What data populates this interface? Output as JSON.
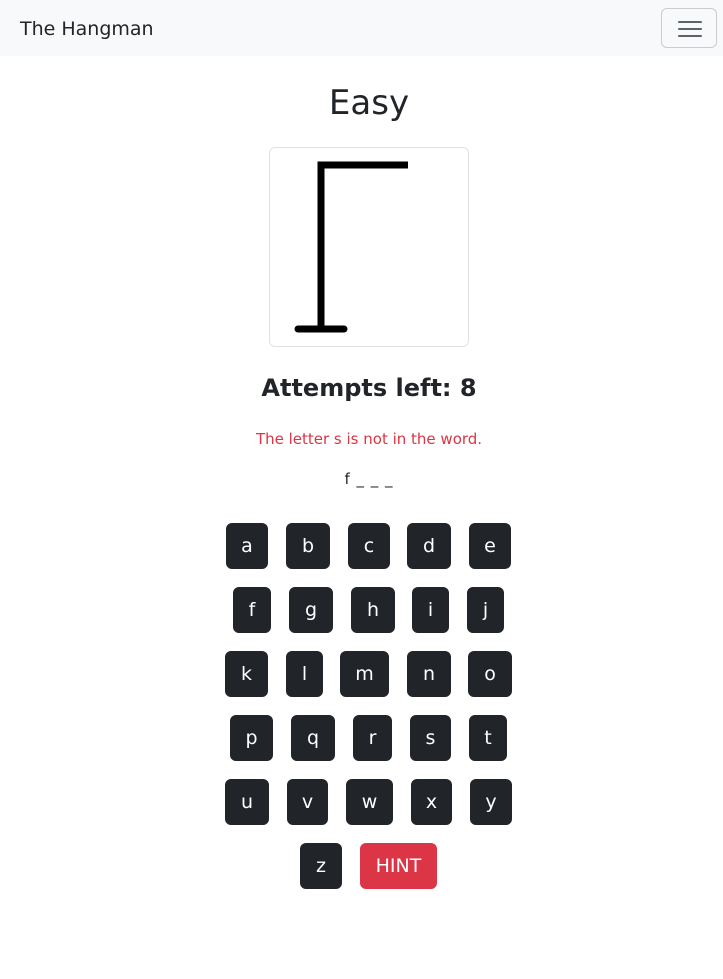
{
  "navbar": {
    "brand": "The Hangman",
    "toggle_icon": "hamburger-menu-icon"
  },
  "game": {
    "level": "Easy",
    "attempts_text": "Attempts left: 8",
    "message": "The letter s is not in the word.",
    "word_progress": "f _ _ _",
    "hint_label": "HINT"
  },
  "colors": {
    "navbar_bg": "#f8f9fa",
    "key_bg": "#212529",
    "hint_bg": "#dc3545",
    "message_text": "#dc3545"
  },
  "keyboard": {
    "keys": [
      "a",
      "b",
      "c",
      "d",
      "e",
      "f",
      "g",
      "h",
      "i",
      "j",
      "k",
      "l",
      "m",
      "n",
      "o",
      "p",
      "q",
      "r",
      "s",
      "t",
      "u",
      "v",
      "w",
      "x",
      "y",
      "z"
    ]
  }
}
